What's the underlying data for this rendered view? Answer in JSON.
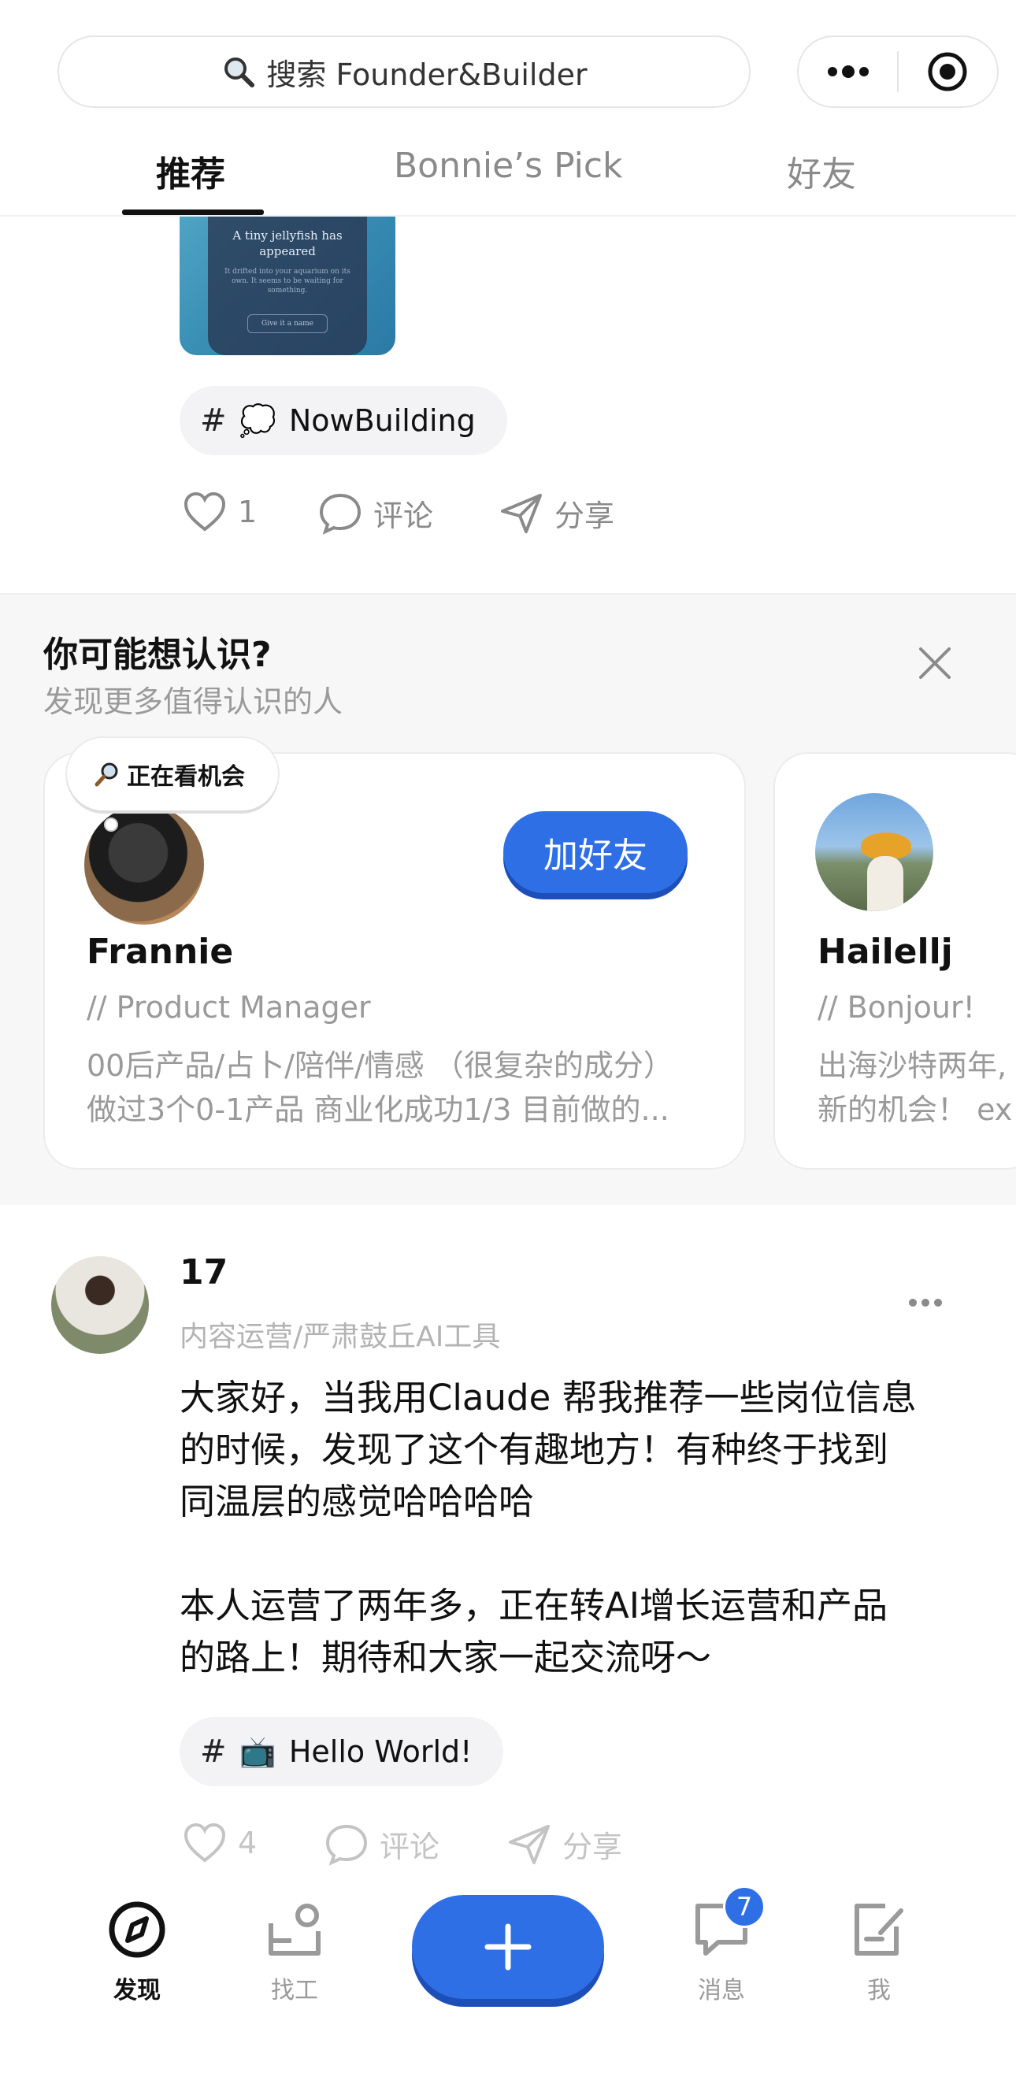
{
  "header": {
    "search_text": "搜索 Founder&Builder"
  },
  "tabs": [
    {
      "label": "推荐",
      "active": true
    },
    {
      "label": "Bonnie’s Pick",
      "active": false
    },
    {
      "label": "好友",
      "active": false
    }
  ],
  "post1": {
    "image": {
      "title": "A tiny jellyfish has appeared",
      "text": "It drifted into your aquarium on its own. It seems to be waiting for something.",
      "button": "Give it a name"
    },
    "tag": {
      "emoji": "💭",
      "label": "NowBuilding"
    },
    "likes": "1",
    "comment_label": "评论",
    "share_label": "分享"
  },
  "suggestions": {
    "title": "你可能想认识?",
    "subtitle": "发现更多值得认识的人",
    "cards": [
      {
        "status": "正在看机会",
        "status_icon": "magnifier",
        "add_label": "加好友",
        "name": "Frannie",
        "title": "// Product Manager",
        "bio1": "00后产品/占卜/陪伴/情感 （很复杂的成分）",
        "bio2": "做过3个0-1产品 商业化成功1/3 目前做的..."
      },
      {
        "name": "Hailellj",
        "title": "// Bonjour!",
        "bio1": "出海沙特两年,",
        "bio2": "新的机会！ ex"
      }
    ]
  },
  "post2": {
    "author": "17",
    "role": "内容运营/严肃鼓丘AI工具",
    "para1": [
      "大家好，当我用Claude 帮我推荐一些岗位信息",
      "的时候，发现了这个有趣地方！有种终于找到",
      "同温层的感觉哈哈哈哈"
    ],
    "para2": [
      "本人运营了两年多，正在转AI增长运营和产品",
      "的路上！期待和大家一起交流呀～"
    ],
    "tag": {
      "emoji": "📺",
      "label": "Hello World!"
    },
    "likes": "4",
    "comment_label": "评论",
    "share_label": "分享"
  },
  "bottom_nav": {
    "items": [
      {
        "label": "发现",
        "active": true
      },
      {
        "label": "找工",
        "active": false
      },
      {
        "label": "消息",
        "active": false,
        "badge": "7"
      },
      {
        "label": "我",
        "active": false
      }
    ]
  },
  "colors": {
    "accent": "#2f6fe6",
    "muted": "#9a9a9a"
  }
}
